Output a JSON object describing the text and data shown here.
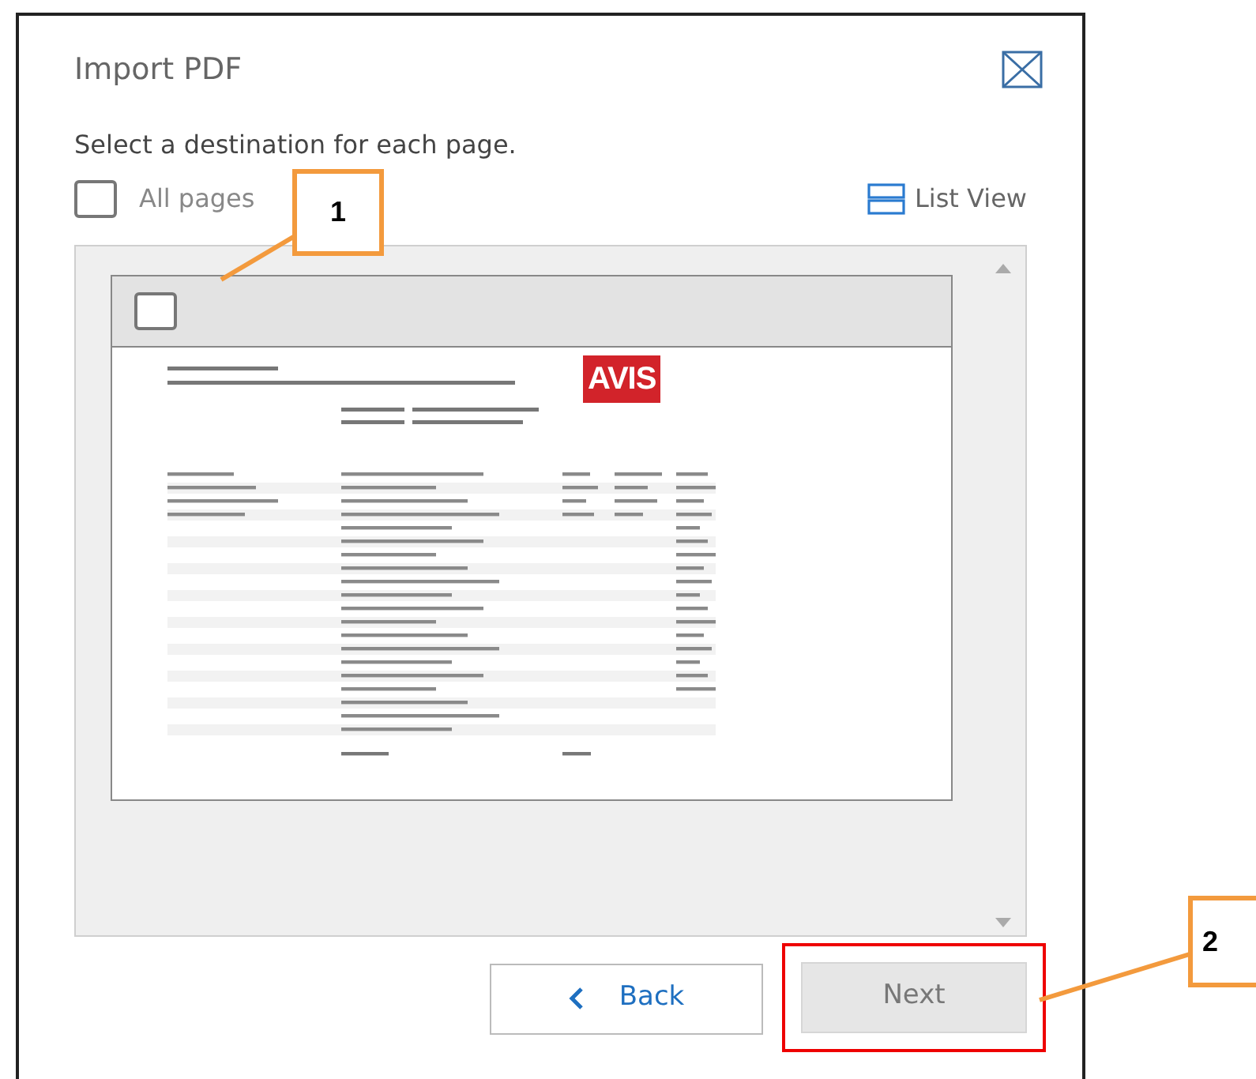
{
  "dialog": {
    "title": "Import PDF",
    "instruction": "Select a destination for each page.",
    "all_pages": {
      "label": "All pages",
      "checked": false
    },
    "view_toggle": {
      "label": "List View"
    },
    "pages": [
      {
        "checked": false,
        "logo": "AVIS"
      }
    ],
    "buttons": [
      {
        "kind": "back",
        "label": "Back",
        "disabled": false,
        "highlighted": false
      },
      {
        "kind": "next",
        "label": "Next",
        "disabled": true,
        "highlighted": true
      }
    ]
  },
  "callouts": [
    {
      "label": "1"
    },
    {
      "label": "2"
    }
  ]
}
